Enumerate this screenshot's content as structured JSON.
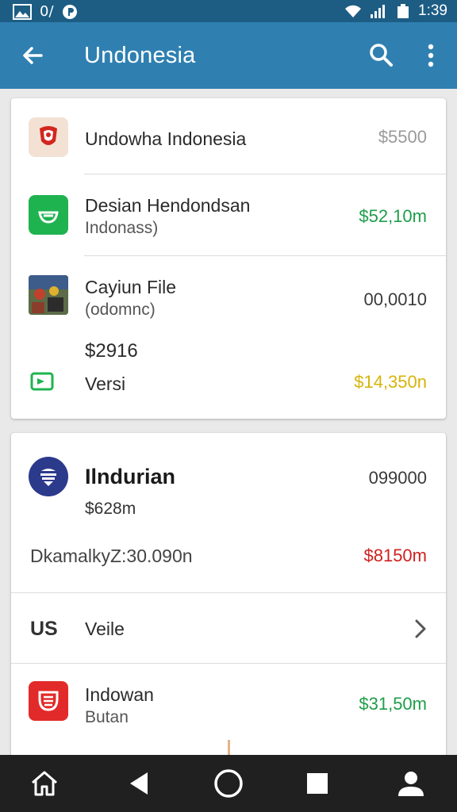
{
  "status_bar": {
    "left_text": "0/",
    "time": "1:39",
    "icons": [
      "gallery-icon",
      "circle-p-icon",
      "wifi-icon",
      "signal-icon",
      "battery-icon"
    ]
  },
  "app_bar": {
    "title": "Undonesia",
    "icons": [
      "back-arrow-icon",
      "search-icon",
      "more-vert-icon"
    ]
  },
  "card1": {
    "rows": [
      {
        "title": "Undowha Indonesia",
        "amount": "$5500",
        "amount_color": "#9a9a9a",
        "icon": "indonesia-emblem-icon"
      },
      {
        "title": "Desian Hendondsan",
        "subtitle": "Indonass)",
        "amount": "$52,10m",
        "amount_color": "#1f9d4a",
        "icon": "green-app-icon"
      },
      {
        "title": "Cayiun File",
        "subtitle": "(odomnc)",
        "amount": "00,0010",
        "amount_color": "#3a3a3a",
        "icon": "photo-thumbnail-icon"
      },
      {
        "price": "$2916"
      },
      {
        "title": "Versi",
        "amount": "$14,350n",
        "amount_color": "#d8b40a",
        "icon": "green-tag-icon"
      }
    ]
  },
  "card2": {
    "header": {
      "title": "Ilndurian",
      "subtitle": "$628m",
      "amount": "099000",
      "icon": "blue-emblem-icon"
    },
    "summary": {
      "label": "DkamalkyZ:30.090n",
      "amount": "$8150m",
      "amount_color": "#d11f1f"
    },
    "country_row": {
      "code": "US",
      "label": "Veile"
    },
    "last_row": {
      "title": "Indowan",
      "subtitle": "Butan",
      "amount": "$31,50m",
      "amount_color": "#1f9d4a",
      "icon": "red-app-icon"
    }
  },
  "bottom_nav": {
    "icons": [
      "home-icon",
      "nav-back-icon",
      "nav-home-circle-icon",
      "nav-recents-icon",
      "profile-icon"
    ]
  }
}
